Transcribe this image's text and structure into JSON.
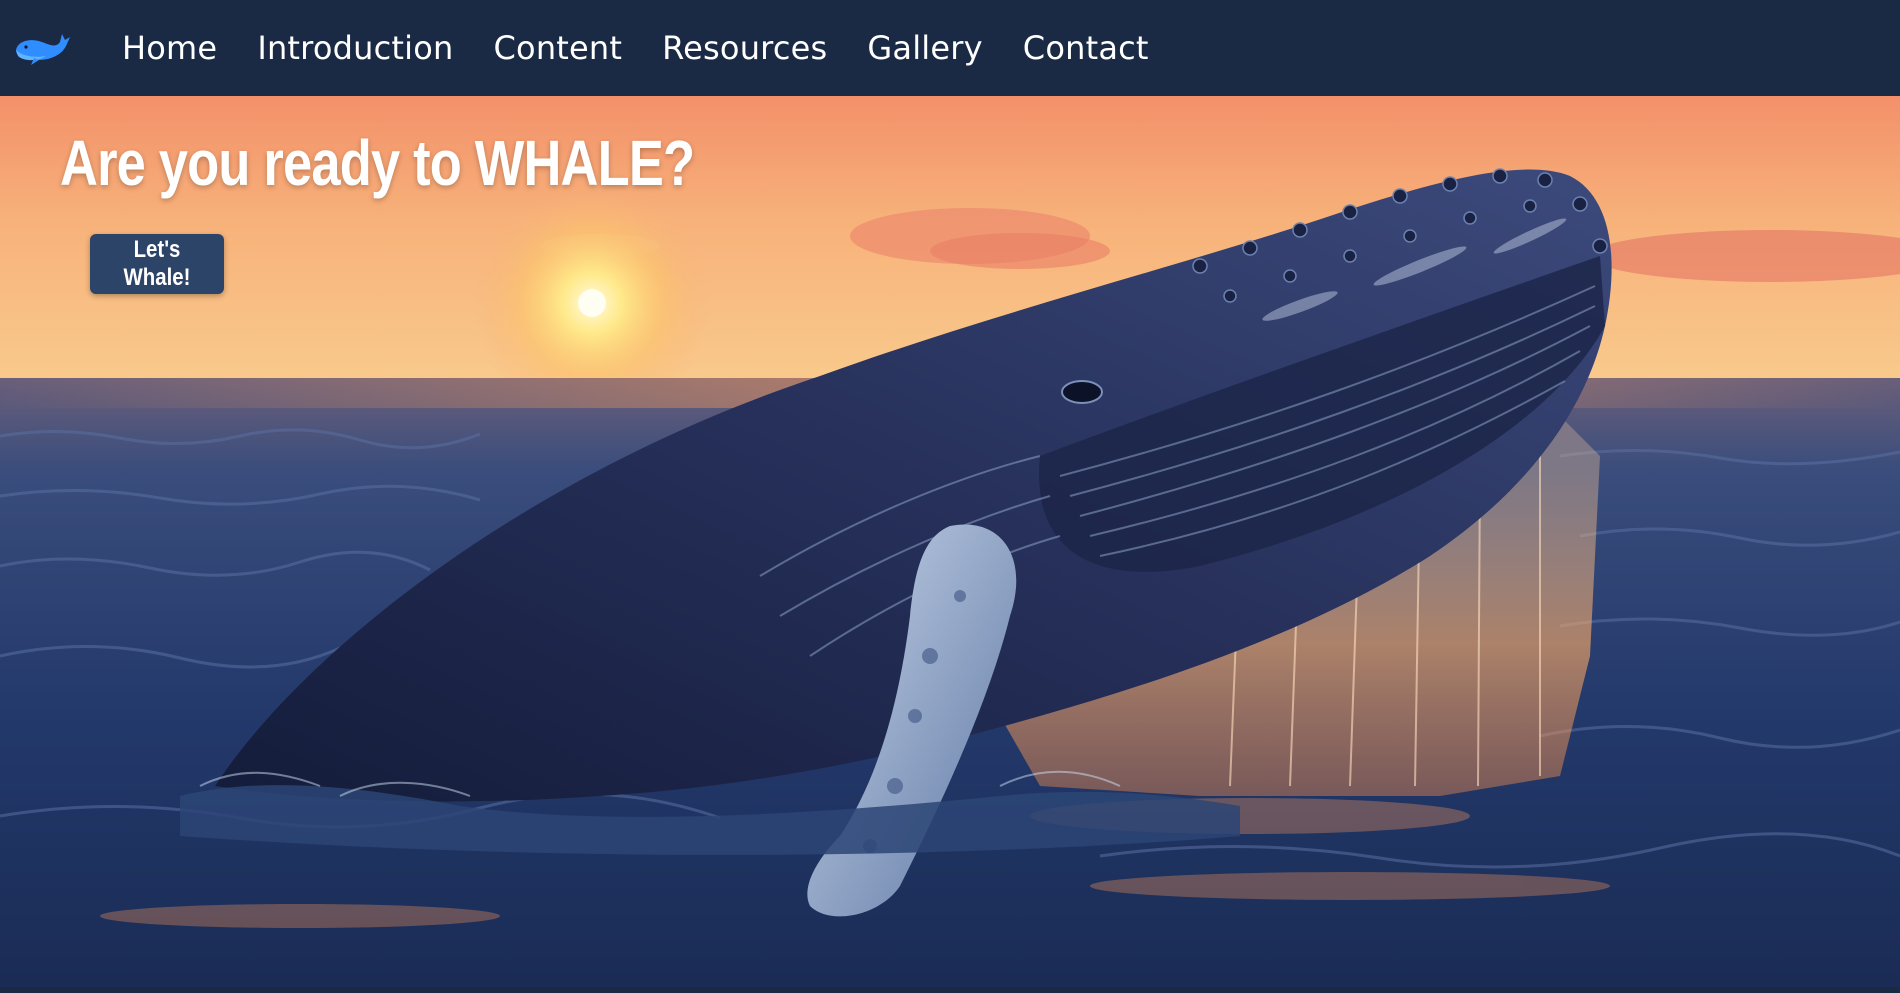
{
  "nav": {
    "logo_icon": "whale-logo-icon",
    "items": [
      {
        "label": "Home"
      },
      {
        "label": "Introduction"
      },
      {
        "label": "Content"
      },
      {
        "label": "Resources"
      },
      {
        "label": "Gallery"
      },
      {
        "label": "Contact"
      }
    ]
  },
  "hero": {
    "title": "Are you ready to WHALE?",
    "cta_label": "Let's Whale!",
    "image_icon": "breaching-whale-sunset-image"
  },
  "colors": {
    "nav_bg": "#1b2a44",
    "cta_bg": "#2c4468",
    "text": "#ffffff",
    "logo": "#2f8dff"
  }
}
